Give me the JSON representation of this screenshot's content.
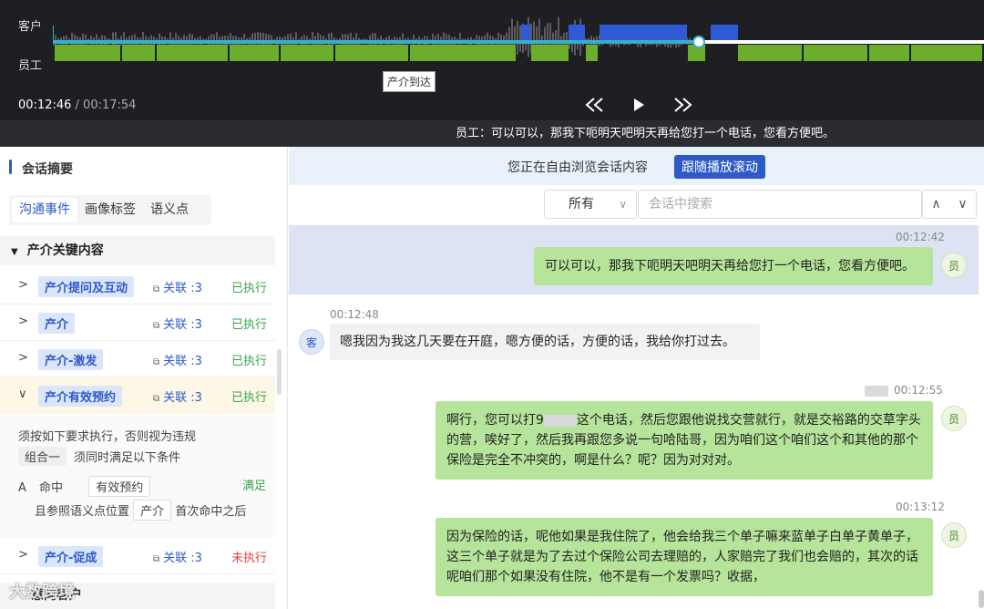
{
  "player": {
    "customer_label": "客户",
    "employee_label": "员工",
    "marker_tip": "产介到达",
    "current_time": "00:12:46",
    "separator": " / ",
    "total_time": "00:17:54",
    "subtitle": "员工：可以可以，那我下呃明天吧明天再给您打一个电话，您看方便吧。",
    "progress_fraction": 0.71,
    "colors": {
      "employee_track": "#6aae2c",
      "customer_track": "#2f5ad6",
      "progress": "#3aaccc"
    }
  },
  "left": {
    "title": "会话摘要",
    "tabs": [
      "沟通事件",
      "画像标签",
      "语义点"
    ],
    "section": "产介关键内容",
    "rows": [
      {
        "tag": "产介提问及互动",
        "link": "关联 :3",
        "status": "已执行"
      },
      {
        "tag": "产介",
        "link": "关联 :3",
        "status": "已执行"
      },
      {
        "tag": "产介-激发",
        "link": "关联 :3",
        "status": "已执行"
      },
      {
        "tag": "产介有效预约",
        "link": "关联 :3",
        "status": "已执行"
      },
      {
        "tag": "产介-促成",
        "link": "关联 :3",
        "status": "未执行"
      }
    ],
    "detail": {
      "line1": "须按如下要求执行，否则视为违规",
      "group": "组合一",
      "group_text": "须同时满足以下条件",
      "a_label": "A",
      "hit": "命中",
      "hit_value": "有效预约",
      "satisfied": "满足",
      "ref_pre": "且参照语义点位置",
      "ref_value": "产介",
      "ref_post": "首次命中之后"
    },
    "watermark": "大数跨境",
    "bottom_section": "意向客户"
  },
  "right": {
    "banner_text": "您正在自由浏览会话内容",
    "follow_button": "跟随播放滚动",
    "filter_value": "所有",
    "search_placeholder": "会话中搜索",
    "messages": [
      {
        "time": "00:12:42",
        "avatar": "员",
        "text": "可以可以，那我下呃明天吧明天再给您打一个电话，您看方便吧。"
      },
      {
        "time": "00:12:48",
        "avatar": "客",
        "text": "嗯我因为我这几天要在开庭，嗯方便的话，方便的话，我给你打过去。"
      },
      {
        "time": "00:12:55",
        "avatar": "员",
        "text_a": "啊行，您可以打9",
        "text_b": "这个电话，然后您跟他说找交营就行，就是交裕路的交草字头的营，唉好了，然后我再跟您多说一句哈陆哥，因为咱们这个咱们这个和其他的那个保险是完全不冲突的，啊是什么？呢？因为对对对。"
      },
      {
        "time": "00:13:12",
        "avatar": "员",
        "text": "因为保险的话，呢他如果是我住院了，他会给我三个单子嘛来蓝单子白单子黄单子，这三个单子就是为了去过个保险公司去理赔的，人家赔完了我们也会赔的，其次的话呢咱们那个如果没有住院，他不是有一个发票吗？收据，"
      }
    ]
  }
}
